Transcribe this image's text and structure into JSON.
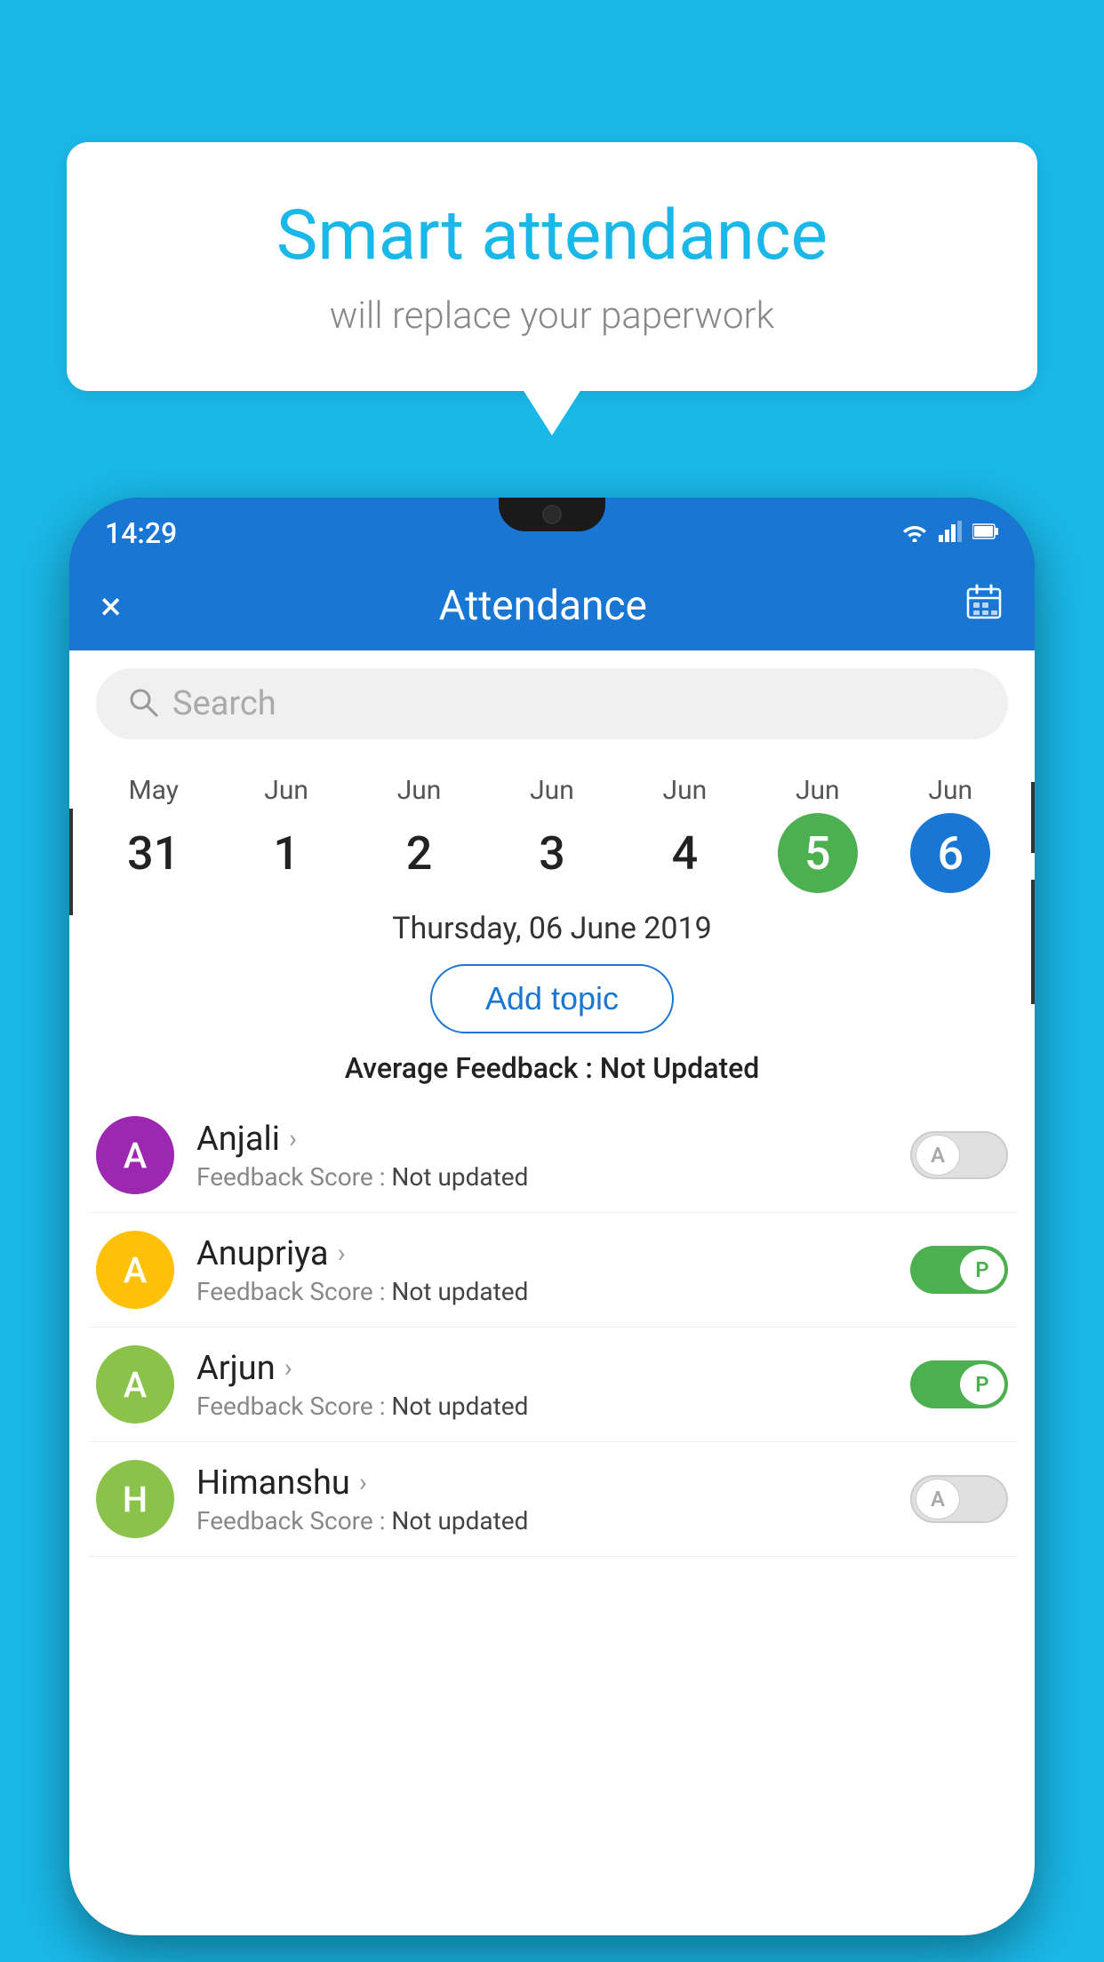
{
  "background_color": "#1ab8e8",
  "speech_bubble": {
    "title": "Smart attendance",
    "subtitle": "will replace your paperwork"
  },
  "status_bar": {
    "time": "14:29",
    "wifi_icon": "▼",
    "signal_icon": "▲",
    "battery_icon": "▮"
  },
  "app_header": {
    "title": "Attendance",
    "close_label": "×",
    "calendar_label": "📅"
  },
  "search": {
    "placeholder": "Search"
  },
  "calendar": {
    "days": [
      {
        "month": "May",
        "date": "31",
        "style": "normal"
      },
      {
        "month": "Jun",
        "date": "1",
        "style": "normal"
      },
      {
        "month": "Jun",
        "date": "2",
        "style": "normal"
      },
      {
        "month": "Jun",
        "date": "3",
        "style": "normal"
      },
      {
        "month": "Jun",
        "date": "4",
        "style": "normal"
      },
      {
        "month": "Jun",
        "date": "5",
        "style": "today"
      },
      {
        "month": "Jun",
        "date": "6",
        "style": "selected"
      }
    ]
  },
  "selected_date_label": "Thursday, 06 June 2019",
  "add_topic_button": "Add topic",
  "avg_feedback_label": "Average Feedback :",
  "avg_feedback_value": "Not Updated",
  "students": [
    {
      "name": "Anjali",
      "avatar_letter": "A",
      "avatar_color": "#9c27b0",
      "feedback_label": "Feedback Score :",
      "feedback_value": "Not updated",
      "attendance": "absent",
      "toggle_label": "A"
    },
    {
      "name": "Anupriya",
      "avatar_letter": "A",
      "avatar_color": "#ffc107",
      "feedback_label": "Feedback Score :",
      "feedback_value": "Not updated",
      "attendance": "present",
      "toggle_label": "P"
    },
    {
      "name": "Arjun",
      "avatar_letter": "A",
      "avatar_color": "#8bc34a",
      "feedback_label": "Feedback Score :",
      "feedback_value": "Not updated",
      "attendance": "present",
      "toggle_label": "P"
    },
    {
      "name": "Himanshu",
      "avatar_letter": "H",
      "avatar_color": "#8bc34a",
      "feedback_label": "Feedback Score :",
      "feedback_value": "Not updated",
      "attendance": "absent",
      "toggle_label": "A"
    }
  ]
}
